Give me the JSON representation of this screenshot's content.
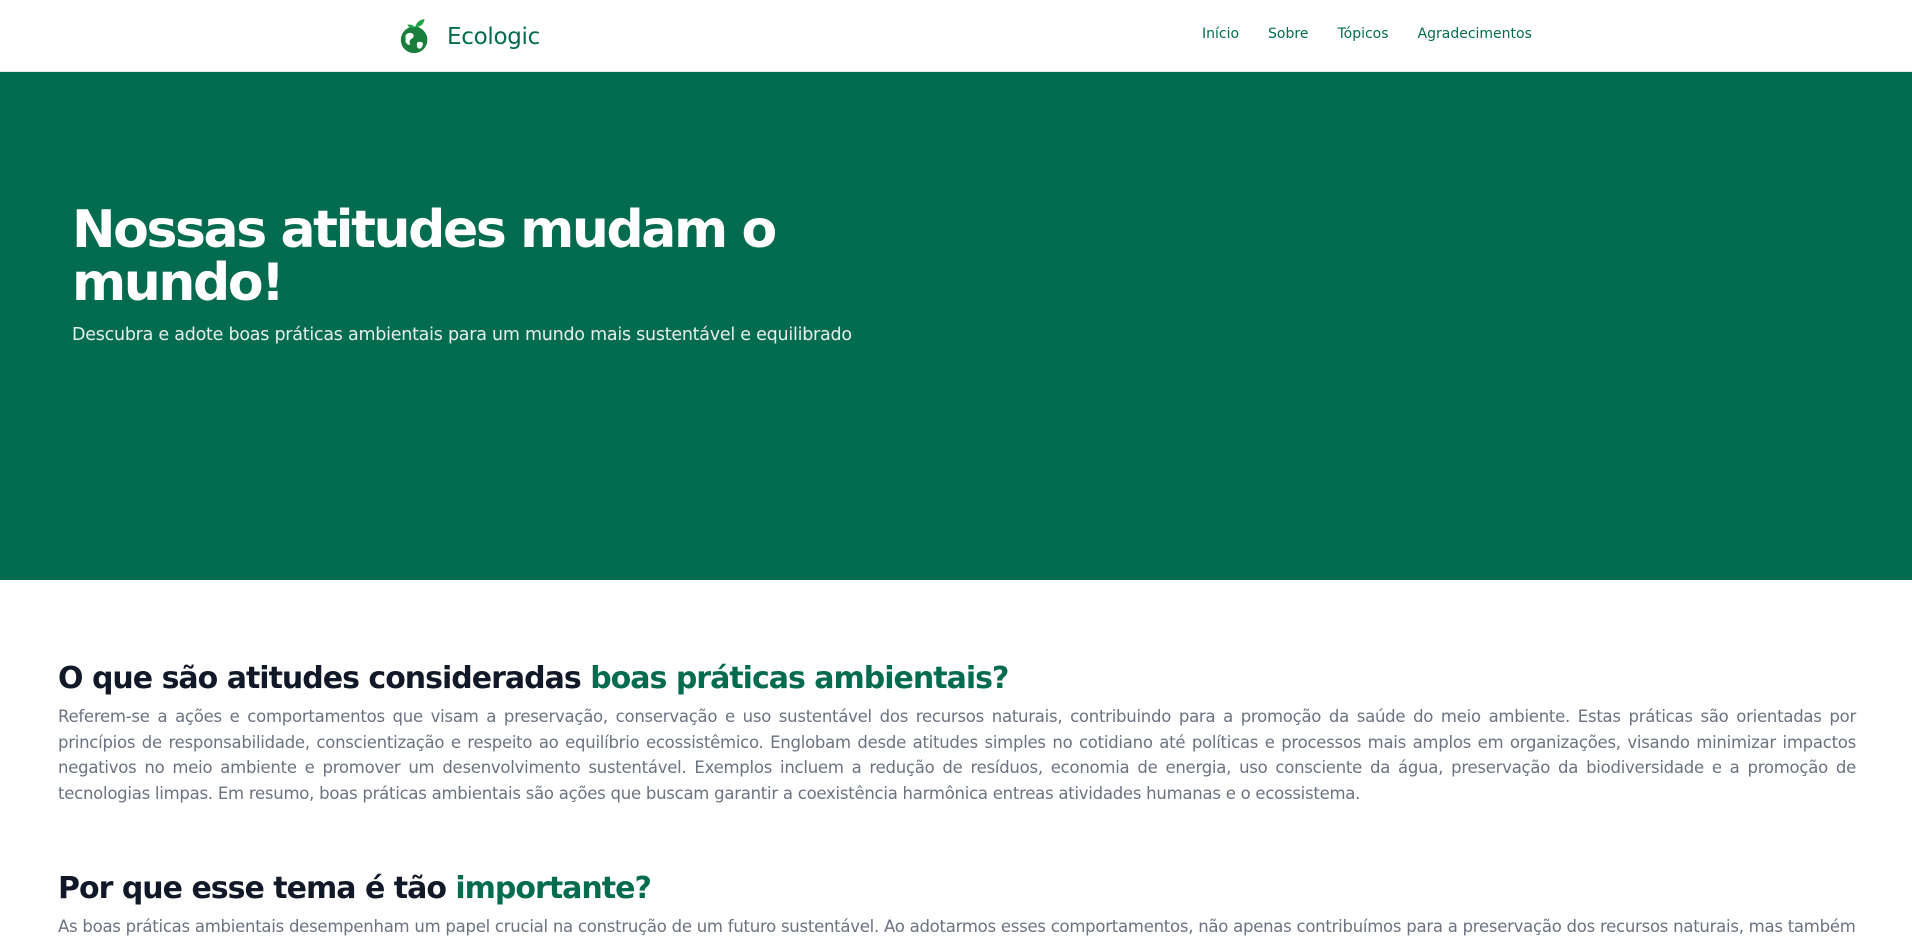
{
  "header": {
    "brand_name": "Ecologic",
    "logo_icon": "globe-leaf-icon",
    "nav": [
      "Início",
      "Sobre",
      "Tópicos",
      "Agradecimentos"
    ]
  },
  "hero": {
    "title": "Nossas atitudes mudam o mundo!",
    "subtitle": "Descubra e adote boas práticas ambientais para um mundo mais sustentável e equilibrado"
  },
  "sections": [
    {
      "title_plain": "O que são atitudes consideradas ",
      "title_highlight": "boas práticas ambientais?",
      "text": "Referem-se a ações e comportamentos que visam a preservação, conservação e uso sustentável dos recursos naturais, contribuindo para a promoção da saúde do meio ambiente. Estas práticas são orientadas por princípios de responsabilidade, conscientização e respeito ao equilíbrio ecossistêmico. Englobam desde atitudes simples no cotidiano até políticas e processos mais amplos em organizações, visando minimizar impactos negativos no meio ambiente e promover um desenvolvimento sustentável. Exemplos incluem a redução de resíduos, economia de energia, uso consciente da água, preservação da biodiversidade e a promoção de tecnologias limpas. Em resumo, boas práticas ambientais são ações que buscam garantir a coexistência harmônica entreas atividades humanas e o ecossistema."
    },
    {
      "title_plain": "Por que esse tema é tão ",
      "title_highlight": "importante?",
      "text": "As boas práticas ambientais desempenham um papel crucial na construção de um futuro sustentável. Ao adotarmos esses comportamentos, não apenas contribuímos para a preservação dos recursos naturais, mas também"
    }
  ],
  "colors": {
    "primary": "#046c4e",
    "heading": "#111827",
    "body_text": "#6b7280"
  }
}
